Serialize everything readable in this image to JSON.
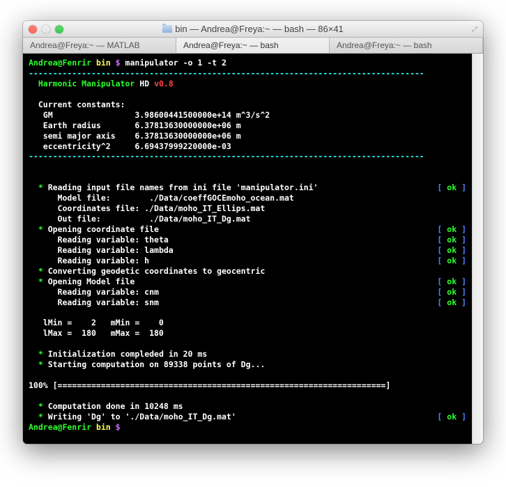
{
  "window": {
    "title": "bin — Andrea@Freya:~ — bash — 86×41"
  },
  "tabs": [
    {
      "label": "Andrea@Freya:~ — MATLAB"
    },
    {
      "label": "Andrea@Freya:~ — bash"
    },
    {
      "label": "Andrea@Freya:~ — bash"
    }
  ],
  "prompt": {
    "userhost": "Andrea@Fenrir",
    "cwd": "bin",
    "sym": "$",
    "command": "manipulator -o 1 -t 2"
  },
  "header": {
    "divider": "----------------------------------------------------------------------------------",
    "app1": "Harmonic Manipulator",
    "app2": "HD",
    "version": "v0.8",
    "consts_label": "Current constants:",
    "rows": [
      {
        "k": "GM",
        "v": "3.98600441500000e+14 m^3/s^2"
      },
      {
        "k": "Earth radius",
        "v": "6.37813630000000e+06 m"
      },
      {
        "k": "semi major axis",
        "v": "6.37813630000000e+06 m"
      },
      {
        "k": "eccentricity^2",
        "v": "6.69437999220000e-03"
      }
    ]
  },
  "log": {
    "l1": "Reading input file names from ini file 'manipulator.ini'",
    "l1a": "Model file:        ./Data/coeffGOCEmoho_ocean.mat",
    "l1b": "Coordinates file: ./Data/moho_IT_Ellips.mat",
    "l1c": "Out file:          ./Data/moho_IT_Dg.mat",
    "l2": "Opening coordinate file",
    "l2a": "Reading variable: theta",
    "l2b": "Reading variable: lambda",
    "l2c": "Reading variable: h",
    "l3": "Converting geodetic coordinates to geocentric",
    "l4": "Opening Model file",
    "l4a": "Reading variable: cnm",
    "l4b": "Reading variable: snm",
    "ranges": "   lMin =    2   mMin =    0\n   lMax =  180   mMax =  180",
    "l5": "Initialization compleded in 20 ms",
    "l6": "Starting computation on 89338 points of Dg...",
    "progress": "100% [====================================================================]",
    "l7": "Computation done in 10248 ms",
    "l8": "Writing 'Dg' to './Data/moho_IT_Dg.mat'",
    "ok": "ok"
  },
  "prompt2": {
    "userhost": "Andrea@Fenrir",
    "cwd": "bin",
    "sym": "$"
  }
}
